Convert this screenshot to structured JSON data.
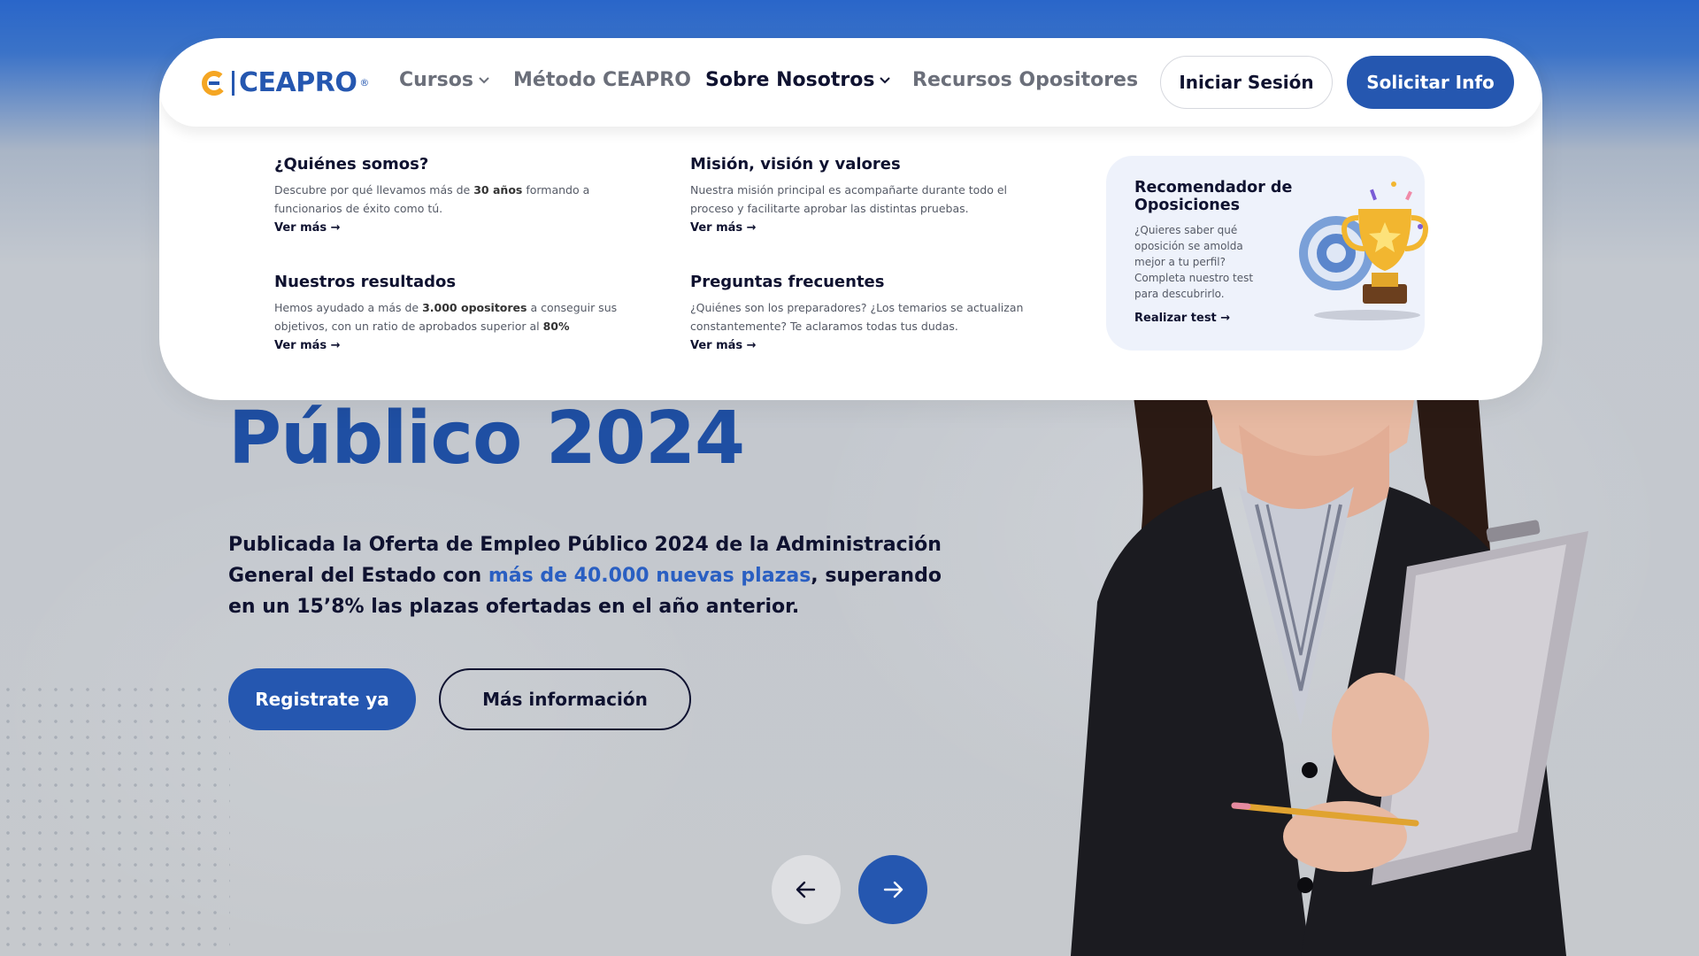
{
  "brand": {
    "logo_text": "CEAPRO",
    "logo_registered": "®"
  },
  "nav": {
    "items": [
      {
        "label": "Cursos",
        "has_dropdown": true,
        "active": false
      },
      {
        "label": "Método CEAPRO",
        "has_dropdown": false,
        "active": false
      },
      {
        "label": "Sobre Nosotros",
        "has_dropdown": true,
        "active": true
      },
      {
        "label": "Recursos Opositores",
        "has_dropdown": false,
        "active": false
      }
    ],
    "login_label": "Iniciar Sesión",
    "info_label": "Solicitar Info"
  },
  "mega_menu": {
    "items": [
      {
        "title": "¿Quiénes somos?",
        "desc_before": "Descubre por qué llevamos más de ",
        "desc_bold": "30 años",
        "desc_after": " formando a funcionarios de éxito como tú.",
        "link": "Ver más →"
      },
      {
        "title": "Misión, visión y valores",
        "desc_before": "Nuestra misión principal es acompañarte durante todo el proceso y facilitarte aprobar las distintas pruebas.",
        "desc_bold": "",
        "desc_after": "",
        "link": "Ver más →"
      },
      {
        "title": "Nuestros resultados",
        "desc_before": "Hemos ayudado a más de ",
        "desc_bold": "3.000 opositores",
        "desc_after": " a conseguir sus objetivos, con un ratio de aprobados superior al ",
        "desc_bold2": "80%",
        "link": "Ver más →"
      },
      {
        "title": "Preguntas frecuentes",
        "desc_before": "¿Quiénes son los preparadores? ¿Los temarios se actualizan constantemente? Te aclaramos todas tus dudas.",
        "desc_bold": "",
        "desc_after": "",
        "link": "Ver más →"
      }
    ],
    "recommender": {
      "title": "Recomendador de Oposiciones",
      "desc": "¿Quieres saber qué oposición se amolda mejor a tu perfil? Completa nuestro test para descubrirlo.",
      "link": "Realizar test →"
    }
  },
  "hero": {
    "title": "Público 2024",
    "desc_part1": "Publicada la Oferta de Empleo Público 2024 de la Administración General del Estado con ",
    "desc_highlight": "más de 40.000 nuevas plazas",
    "desc_part2": ", superando en un 15’8% las plazas ofertadas en el año anterior.",
    "register_label": "Registrate ya",
    "more_label": "Más información"
  },
  "colors": {
    "brand_blue": "#2557b0",
    "title_blue": "#1f4fa3",
    "highlight_blue": "#2a5fc2",
    "dark_text": "#0f1230",
    "logo_accent": "#f5a623"
  }
}
